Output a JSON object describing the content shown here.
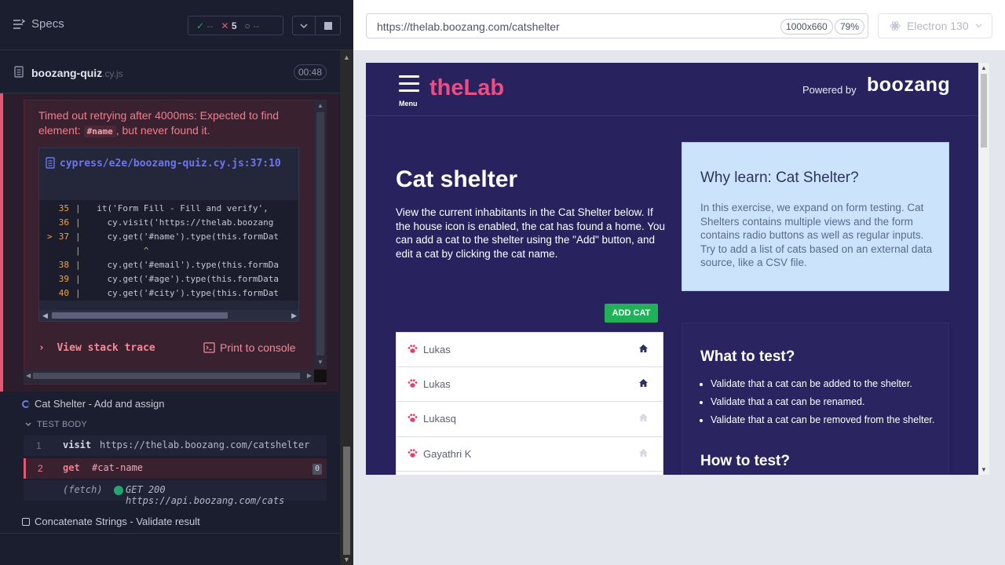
{
  "reporter": {
    "specs_label": "Specs",
    "stats": {
      "passed": "--",
      "failed": "5",
      "pending": "--"
    },
    "spec": {
      "name": "boozang-quiz",
      "ext": ".cy.js",
      "duration": "00:48"
    },
    "error": {
      "message_pre": "Timed out retrying after 4000ms: Expected to find element:",
      "message_code": "#name",
      "message_post": ", but never found it.",
      "file_link": "cypress/e2e/boozang-quiz.cy.js:37:10",
      "code_lines": [
        {
          "num": "35",
          "src": "  it('Form Fill - Fill and verify', "
        },
        {
          "num": "36",
          "src": "    cy.visit('https://thelab.boozang"
        },
        {
          "num": "37",
          "src": "    cy.get('#name').type(this.formDat"
        },
        {
          "num": "",
          "src": "           ^"
        },
        {
          "num": "38",
          "src": "    cy.get('#email').type(this.formDa"
        },
        {
          "num": "39",
          "src": "    cy.get('#age').type(this.formData"
        },
        {
          "num": "40",
          "src": "    cy.get('#city').type(this.formDat"
        }
      ],
      "view_stack": "View stack trace",
      "print_console": "Print to console"
    },
    "tests": {
      "running": "Cat Shelter - Add and assign",
      "body_label": "TEST BODY",
      "commands": [
        {
          "num": "1",
          "name": "visit",
          "message": "https://thelab.boozang.com/catshelter"
        },
        {
          "num": "2",
          "name": "get",
          "message": "#cat-name",
          "count": "0"
        },
        {
          "num": "",
          "name": "(fetch)",
          "message": "GET 200 https://api.boozang.com/cats"
        }
      ],
      "next": "Concatenate Strings - Validate result"
    }
  },
  "aut": {
    "url": "https://thelab.boozang.com/catshelter",
    "viewport": "1000x660",
    "zoom": "79%",
    "browser": "Electron 130",
    "page": {
      "menu_label": "Menu",
      "logo": "theLab",
      "powered_by": "Powered by",
      "brand": "boozang",
      "title": "Cat shelter",
      "description": "View the current inhabitants in the Cat Shelter below. If the house icon is enabled, the cat has found a home. You can add a cat to the shelter using the \"Add\" button, and edit a cat by clicking the cat name.",
      "add_button": "ADD CAT",
      "cats": [
        {
          "name": "Lukas",
          "home": true
        },
        {
          "name": "Lukas",
          "home": true
        },
        {
          "name": "Lukasq",
          "home": false
        },
        {
          "name": "Gayathri K",
          "home": false
        },
        {
          "name": "",
          "home": false
        }
      ],
      "why_title": "Why learn: Cat Shelter?",
      "why_text": "In this exercise, we expand on form testing. Cat Shelters contains multiple views and the form contains radio buttons as well as regular inputs. Try to add a list of cats based on an external data source, like a CSV file.",
      "what_title": "What to test?",
      "what_items": [
        "Validate that a cat can be added to the shelter.",
        "Validate that a cat can be renamed.",
        "Validate that a cat can be removed from the shelter."
      ],
      "how_title": "How to test?"
    }
  },
  "colors": {
    "reporter_bg": "#1b1e2e",
    "fail": "#e45770",
    "pass": "#1fa971",
    "lab_bg": "#28235f",
    "lab_pink": "#ec4d83",
    "why_bg": "#cce4fb",
    "add_green": "#21b15a"
  }
}
